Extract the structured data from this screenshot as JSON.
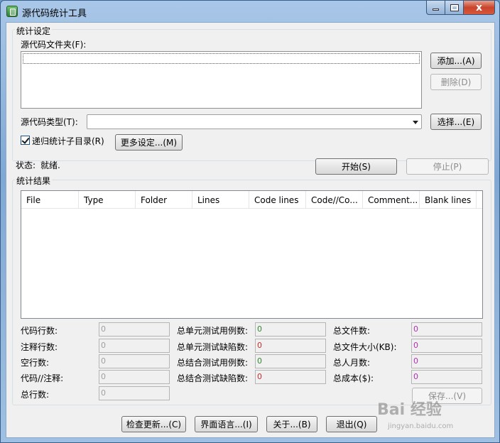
{
  "window": {
    "title": "源代码统计工具",
    "controls": {
      "minimize_icon": "minimize-icon",
      "maximize_icon": "maximize-icon",
      "close_label": "x"
    }
  },
  "settings": {
    "group_title": "统计设定",
    "folder_label": "源代码文件夹(F):",
    "add_button": "添加...(A)",
    "delete_button": "删除(D)",
    "type_label": "源代码类型(T):",
    "type_value": "",
    "choose_button": "选择...(E)",
    "recursive_label": "递归统计子目录(R)",
    "recursive_checked": true,
    "more_settings_button": "更多设定...(M)"
  },
  "status": {
    "label": "状态:",
    "value": "就绪.",
    "start_button": "开始(S)",
    "stop_button": "停止(P)"
  },
  "results": {
    "group_title": "统计结果",
    "columns": [
      "File",
      "Type",
      "Folder",
      "Lines",
      "Code lines",
      "Code//Co...",
      "Comment...",
      "Blank lines"
    ],
    "rows": []
  },
  "stats": {
    "left": [
      {
        "label": "代码行数:",
        "value": "0"
      },
      {
        "label": "注释行数:",
        "value": "0"
      },
      {
        "label": "空行数:",
        "value": "0"
      },
      {
        "label": "代码//注释:",
        "value": "0"
      },
      {
        "label": "总行数:",
        "value": "0"
      }
    ],
    "middle": [
      {
        "label": "总单元测试用例数:",
        "value": "0"
      },
      {
        "label": "总单元测试缺陷数:",
        "value": "0"
      },
      {
        "label": "总结合测试用例数:",
        "value": "0"
      },
      {
        "label": "总结合测试缺陷数:",
        "value": "0"
      }
    ],
    "right": [
      {
        "label": "总文件数:",
        "value": "0"
      },
      {
        "label": "总文件大小(KB):",
        "value": "0"
      },
      {
        "label": "总人月数:",
        "value": "0"
      },
      {
        "label": "总成本($):",
        "value": "0"
      }
    ],
    "save_button": "保存...(V)",
    "colors": {
      "gray": "#a0a0a0",
      "green": "#2e8b2e",
      "red": "#c03030",
      "magenta": "#b030b0"
    }
  },
  "footer": {
    "check_update_button": "检查更新...(C)",
    "language_button": "界面语言...(I)",
    "about_button": "关于...(B)",
    "exit_button": "退出(Q)"
  },
  "watermark": {
    "text": "Bai 经验",
    "sub": "jingyan.baidu.com"
  }
}
